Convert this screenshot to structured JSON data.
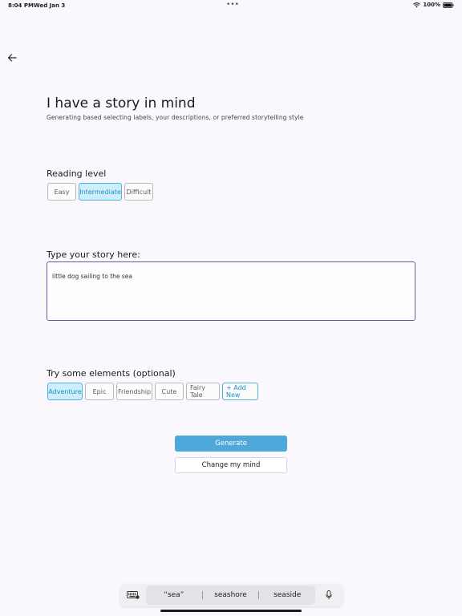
{
  "status_bar": {
    "time": "8:04 PM",
    "date": "Wed Jan 3",
    "battery": "100%"
  },
  "icons": {
    "back": "arrow-left-icon",
    "wifi": "wifi-icon",
    "battery": "battery-icon",
    "keyboard": "keyboard-icon",
    "mic": "microphone-icon"
  },
  "header": {
    "title": "I have a story in mind",
    "subtitle": "Generating based selecting labels, your descriptions, or preferred storytelling style"
  },
  "reading_level": {
    "label": "Reading level",
    "options": [
      "Easy",
      "Intermediate",
      "Difficult"
    ],
    "selected": "Intermediate"
  },
  "story": {
    "label": "Type your story here:",
    "value": "little dog sailing to the sea"
  },
  "elements": {
    "label": "Try some elements (optional)",
    "options": [
      "Adventure",
      "Epic",
      "Friendship",
      "Cute",
      "Fairy Tale"
    ],
    "selected": [
      "Adventure"
    ],
    "add_label": "+ Add New"
  },
  "actions": {
    "generate_label": "Generate",
    "change_label": "Change my mind"
  },
  "keyboard": {
    "suggestions": [
      "“sea”",
      "seashore",
      "seaside"
    ]
  },
  "colors": {
    "accent": "#4ea8d9",
    "selected_chip_bg": "#cfeefc",
    "focus_border": "#6a5aa8",
    "background": "#fbf8fd"
  }
}
